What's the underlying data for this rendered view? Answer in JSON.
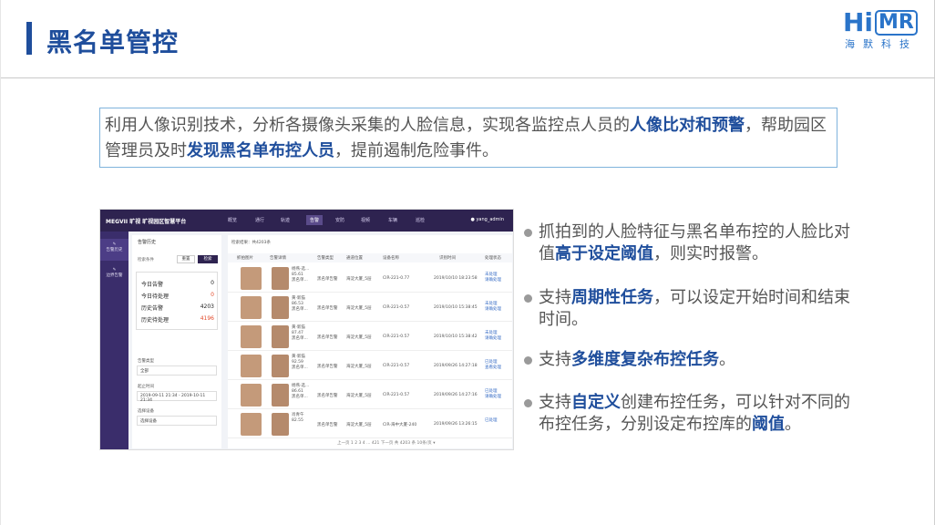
{
  "title": "黑名单管控",
  "logo": {
    "main": "Hi",
    "boxed": "MR",
    "sub": "海默科技"
  },
  "intro": {
    "p1": "利用人像识别技术，分析各摄像头采集的人脸信息，实现各监控点人员的",
    "b1": "人像比对和预警",
    "p2": "，帮助园区管理员及时",
    "b2": "发现黑名单布控人员",
    "p3": "，提前遏制危险事件。"
  },
  "app": {
    "brand": "MEGVII 旷视  旷视园区智慧平台",
    "nav": [
      "概览",
      "通行",
      "轨迹",
      "告警",
      "安防",
      "视频",
      "车辆",
      "巡检"
    ],
    "nav_active_index": 3,
    "user": "yang_admin",
    "sidebar": [
      "告警历史",
      "边界告警"
    ],
    "panel_title": "告警历史",
    "condition_label": "检索条件",
    "reset": "重置",
    "query": "检索",
    "stats": [
      {
        "label": "今日告警",
        "value": "0"
      },
      {
        "label": "今日待处理",
        "value": "0"
      },
      {
        "label": "历史告警",
        "value": "4203"
      },
      {
        "label": "历史待处理",
        "value": "4196"
      }
    ],
    "filter": {
      "type_label": "告警类型",
      "type_value": "全部",
      "time_label": "起止时间",
      "time_value": "2019-09-11 21:34 - 2019-10-11 21:34",
      "device_label": "选择设备",
      "device_placeholder": "选择设备"
    },
    "total": "检索结果：共4203条",
    "columns": [
      "抓拍图片",
      "告警详情",
      "告警类型",
      "通道位置",
      "设备名称",
      "识别时间",
      "处理状态"
    ],
    "rows": [
      {
        "detail": "杨燕·选...\n85.61\n黑名单...",
        "type": "黑名单告警",
        "loc": "海淀大厦_5层",
        "device": "CIR-221-0.77",
        "time": "2019/10/10 18:23:58",
        "status": "未处理\n请确处理"
      },
      {
        "detail": "黄·新猫\n86.53\n黑名单...",
        "type": "黑名单告警",
        "loc": "海淀大厦_5层",
        "device": "CIR-221-0.57",
        "time": "2019/10/10 15:38:45",
        "status": "未处理\n请确处理"
      },
      {
        "detail": "黄·新猫\n87.47\n黑名单...",
        "type": "黑名单告警",
        "loc": "海淀大厦_5层",
        "device": "CIR-221-0.57",
        "time": "2019/10/10 15:38:42",
        "status": "未处理\n请确处理"
      },
      {
        "detail": "黄·新猫\n92.59\n黑名单...",
        "type": "黑名单告警",
        "loc": "海淀大厦_5层",
        "device": "CIR-221-0.57",
        "time": "2019/09/26 14:27:18",
        "status": "已处理\n查看处理"
      },
      {
        "detail": "杨燕·选...\n86.61\n黑名单...",
        "type": "黑名单告警",
        "loc": "海淀大厦_5层",
        "device": "CIR-221-0.57",
        "time": "2019/09/26 14:27:16",
        "status": "已处理\n请确处理"
      },
      {
        "detail": "肖青午\n82.55",
        "type": "黑名单告警",
        "loc": "海淀大厦_5层",
        "device": "CIR-海中大厦-240",
        "time": "2019/09/26 13:26:15",
        "status": "已处理"
      }
    ],
    "pager": "上一页  1  2  3  4  ...  421  下一页      共 4203 条    10条/页 ▾"
  },
  "bullets": [
    {
      "p1": "抓拍到的人脸特征与黑名单布控的人脸比对值",
      "b1": "高于设定阈值",
      "p2": "，则实时报警。"
    },
    {
      "p1": "支持",
      "b1": "周期性任务",
      "p2": "，可以设定开始时间和结束时间。"
    },
    {
      "p1": "支持",
      "b1": "多维度复杂布控任务",
      "p2": "。"
    },
    {
      "p1": "支持",
      "b1": "自定义",
      "p2": "创建布控任务，可以针对不同的布控任务，分别设定布控库的",
      "b2": "阈值",
      "p3": "。"
    }
  ]
}
